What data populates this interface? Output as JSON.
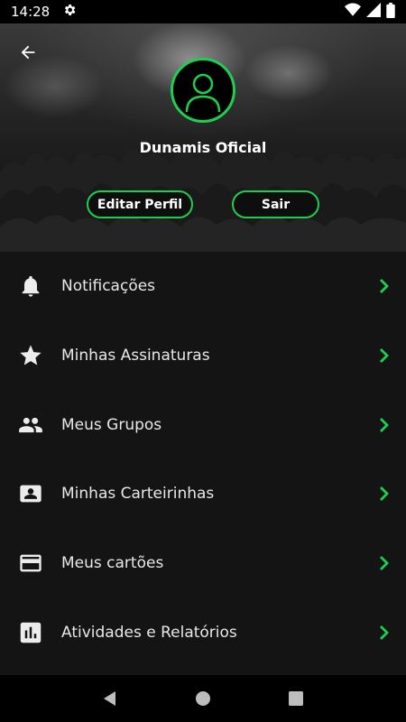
{
  "status_bar": {
    "time": "14:28"
  },
  "profile": {
    "name": "Dunamis Oficial"
  },
  "actions": {
    "edit_label": "Editar Perfil",
    "logout_label": "Sair"
  },
  "menu": [
    {
      "label": "Notificações",
      "icon": "bell-icon"
    },
    {
      "label": "Minhas Assinaturas",
      "icon": "star-icon"
    },
    {
      "label": "Meus Grupos",
      "icon": "group-icon"
    },
    {
      "label": "Minhas Carteirinhas",
      "icon": "id-card-icon"
    },
    {
      "label": "Meus cartões",
      "icon": "credit-card-icon"
    },
    {
      "label": "Atividades e Relatórios",
      "icon": "bar-chart-icon"
    }
  ],
  "colors": {
    "accent": "#1ecf4f",
    "background": "#141414",
    "status_bar": "#000000"
  }
}
